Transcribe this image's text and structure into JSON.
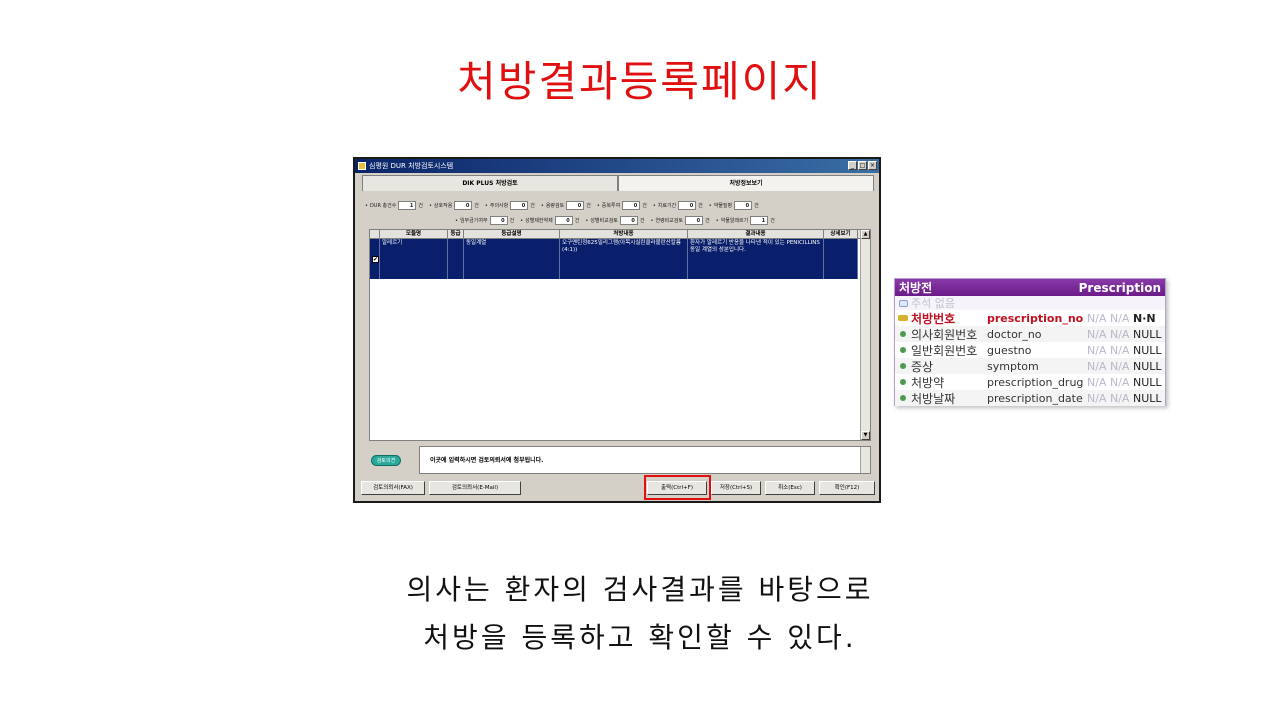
{
  "slide": {
    "title": "처방결과등록페이지",
    "caption_line1": "의사는 환자의 검사결과를 바탕으로",
    "caption_line2": "처방을 등록하고 확인할 수 있다."
  },
  "dur_window": {
    "title": "심평원 DUR 처방검토시스템",
    "win_buttons": [
      "_",
      "□",
      "×"
    ],
    "tabs": [
      {
        "label": "DIK PLUS 처방검토",
        "active": true
      },
      {
        "label": "처방정보보기",
        "active": false
      }
    ],
    "stats_row1": [
      {
        "label": "DUR 총건수",
        "value": "1",
        "unit": "건"
      },
      {
        "label": "상호작용",
        "value": "0",
        "unit": "건"
      },
      {
        "label": "주의사항",
        "value": "0",
        "unit": "건"
      },
      {
        "label": "용량검토",
        "value": "0",
        "unit": "건"
      },
      {
        "label": "중복투여",
        "value": "0",
        "unit": "건"
      },
      {
        "label": "치료기간",
        "value": "0",
        "unit": "건"
      },
      {
        "label": "약물질병",
        "value": "0",
        "unit": "건"
      }
    ],
    "stats_row2": [
      {
        "label": "임부금기여부",
        "value": "0",
        "unit": "건"
      },
      {
        "label": "성별제한약제",
        "value": "0",
        "unit": "건"
      },
      {
        "label": "성별비교검토",
        "value": "0",
        "unit": "건"
      },
      {
        "label": "연령비교검토",
        "value": "0",
        "unit": "건"
      },
      {
        "label": "약물알레르기",
        "value": "1",
        "unit": "건"
      }
    ],
    "grid_headers": [
      "모듈명",
      "등급",
      "등급설명",
      "처방내용",
      "결과내용",
      "상세보기"
    ],
    "grid_row": {
      "module": "알레르기",
      "grade": "",
      "grade_desc": "동일계열",
      "prescription": "오구멘틴정625밀리그램(아목시실린클라불란산칼륨(4:1))",
      "result": "환자가 알레르기 반응을 나타낸 적이 있는 PENICILLINS 동일 계열의 성분입니다."
    },
    "memo_button": "검토의견",
    "memo_text": "이곳에 입력하시면 검토의뢰서에 첨부됩니다.",
    "buttons": {
      "fax": "검토의뢰서(FAX)",
      "email": "검토의뢰서(E-Mail)",
      "print": "출력(Ctrl+F)",
      "save": "저장(Ctrl+S)",
      "cancel": "취소(Esc)",
      "confirm": "확인(F12)"
    }
  },
  "rx_table": {
    "name_kr": "처방전",
    "name_en": "Prescription",
    "note": "주석 없음",
    "columns": [
      {
        "kname": "처방번호",
        "pname": "prescription_no",
        "na": "N/A N/A",
        "null": "N·N",
        "pk": true
      },
      {
        "kname": "의사회원번호",
        "pname": "doctor_no",
        "na": "N/A N/A",
        "null": "NULL",
        "pk": false
      },
      {
        "kname": "일반회원번호",
        "pname": "guestno",
        "na": "N/A N/A",
        "null": "NULL",
        "pk": false
      },
      {
        "kname": "증상",
        "pname": "symptom",
        "na": "N/A N/A",
        "null": "NULL",
        "pk": false
      },
      {
        "kname": "처방약",
        "pname": "prescription_drug",
        "na": "N/A N/A",
        "null": "NULL",
        "pk": false
      },
      {
        "kname": "처방날짜",
        "pname": "prescription_date",
        "na": "N/A N/A",
        "null": "NULL",
        "pk": false
      }
    ]
  }
}
